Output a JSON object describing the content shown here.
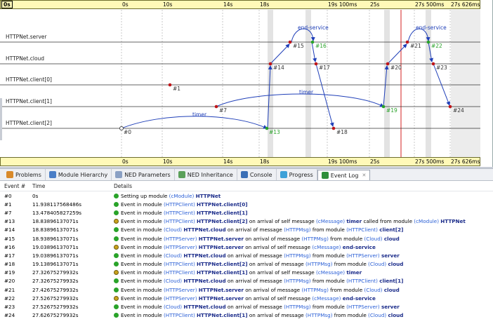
{
  "ruler": {
    "ticks": [
      "0s",
      "0s",
      "10s",
      "14s",
      "18s",
      "19s 100ms",
      "25s",
      "27s 500ms",
      "27s 626ms"
    ]
  },
  "lanes": [
    "HTTPNet.server",
    "HTTPNet.cloud",
    "HTTPNet.client[0]",
    "HTTPNet.client[1]",
    "HTTPNet.client[2]"
  ],
  "events": {
    "e0": "#0",
    "e1": "#1",
    "e7": "#7",
    "e13": "#13",
    "e14": "#14",
    "e15": "#15",
    "e16": "#16",
    "e17": "#17",
    "e18": "#18",
    "e19": "#19",
    "e20": "#20",
    "e21": "#21",
    "e22": "#22",
    "e23": "#23",
    "e24": "#24"
  },
  "msgs": {
    "timer1": "timer",
    "timer2": "timer",
    "end1": "end-service",
    "end2": "end-service"
  },
  "tabs": [
    {
      "label": "Problems",
      "icon": "problems-icon"
    },
    {
      "label": "Module Hierarchy",
      "icon": "module-hierarchy-icon"
    },
    {
      "label": "NED Parameters",
      "icon": "ned-parameters-icon"
    },
    {
      "label": "NED Inheritance",
      "icon": "ned-inheritance-icon"
    },
    {
      "label": "Console",
      "icon": "console-icon"
    },
    {
      "label": "Progress",
      "icon": "progress-icon"
    },
    {
      "label": "Event Log",
      "icon": "event-log-icon",
      "close": "✕"
    }
  ],
  "log_head": {
    "event": "Event #",
    "time": "Time",
    "details": "Details"
  },
  "log_rows": [
    {
      "ev": "#0",
      "time": "0s",
      "kind": "normal",
      "parts": [
        [
          "",
          "Setting up module "
        ],
        [
          "tn",
          "(cModule) "
        ],
        [
          "bn",
          "HTTPNet"
        ]
      ]
    },
    {
      "ev": "#1",
      "time": "11.938117568486s",
      "kind": "normal",
      "parts": [
        [
          "",
          "Event in module "
        ],
        [
          "tn",
          "(HTTPClient) "
        ],
        [
          "bn",
          "HTTPNet.client[0]"
        ]
      ]
    },
    {
      "ev": "#7",
      "time": "13.478405827259s",
      "kind": "normal",
      "parts": [
        [
          "",
          "Event in module "
        ],
        [
          "tn",
          "(HTTPClient) "
        ],
        [
          "bn",
          "HTTPNet.client[1]"
        ]
      ]
    },
    {
      "ev": "#13",
      "time": "18.83896137071s",
      "kind": "self",
      "parts": [
        [
          "",
          "Event in module "
        ],
        [
          "tn",
          "(HTTPClient) "
        ],
        [
          "bn",
          "HTTPNet.client[2]"
        ],
        [
          "",
          " on arrival of self message "
        ],
        [
          "tn",
          "(cMessage) "
        ],
        [
          "bn",
          "timer"
        ],
        [
          "",
          " called from module "
        ],
        [
          "tn",
          "(cModule) "
        ],
        [
          "bn",
          "HTTPNet"
        ]
      ]
    },
    {
      "ev": "#14",
      "time": "18.83896137071s",
      "kind": "normal",
      "parts": [
        [
          "",
          "Event in module "
        ],
        [
          "tn",
          "(Cloud) "
        ],
        [
          "bn",
          "HTTPNet.cloud"
        ],
        [
          "",
          " on arrival of message "
        ],
        [
          "tn",
          "(HTTPMsg)"
        ],
        [
          "",
          "  from module "
        ],
        [
          "tn",
          "(HTTPClient) "
        ],
        [
          "bn",
          "client[2]"
        ]
      ]
    },
    {
      "ev": "#15",
      "time": "18.93896137071s",
      "kind": "normal",
      "parts": [
        [
          "",
          "Event in module "
        ],
        [
          "tn",
          "(HTTPServer) "
        ],
        [
          "bn",
          "HTTPNet.server"
        ],
        [
          "",
          " on arrival of message "
        ],
        [
          "tn",
          "(HTTPMsg)"
        ],
        [
          "",
          "  from module "
        ],
        [
          "tn",
          "(Cloud) "
        ],
        [
          "bn",
          "cloud"
        ]
      ]
    },
    {
      "ev": "#16",
      "time": "19.03896137071s",
      "kind": "self",
      "parts": [
        [
          "",
          "Event in module "
        ],
        [
          "tn",
          "(HTTPServer) "
        ],
        [
          "bn",
          "HTTPNet.server"
        ],
        [
          "",
          " on arrival of self message "
        ],
        [
          "tn",
          "(cMessage) "
        ],
        [
          "bn",
          "end-service"
        ]
      ]
    },
    {
      "ev": "#17",
      "time": "19.03896137071s",
      "kind": "normal",
      "parts": [
        [
          "",
          "Event in module "
        ],
        [
          "tn",
          "(Cloud) "
        ],
        [
          "bn",
          "HTTPNet.cloud"
        ],
        [
          "",
          " on arrival of message "
        ],
        [
          "tn",
          "(HTTPMsg)"
        ],
        [
          "",
          "  from module "
        ],
        [
          "tn",
          "(HTTPServer) "
        ],
        [
          "bn",
          "server"
        ]
      ]
    },
    {
      "ev": "#18",
      "time": "19.13896137071s",
      "kind": "normal",
      "parts": [
        [
          "",
          "Event in module "
        ],
        [
          "tn",
          "(HTTPClient) "
        ],
        [
          "bn",
          "HTTPNet.client[2]"
        ],
        [
          "",
          " on arrival of message "
        ],
        [
          "tn",
          "(HTTPMsg)"
        ],
        [
          "",
          "  from module "
        ],
        [
          "tn",
          "(Cloud) "
        ],
        [
          "bn",
          "cloud"
        ]
      ]
    },
    {
      "ev": "#19",
      "time": "27.32675279932s",
      "kind": "self",
      "parts": [
        [
          "",
          "Event in module "
        ],
        [
          "tn",
          "(HTTPClient) "
        ],
        [
          "bn",
          "HTTPNet.client[1]"
        ],
        [
          "",
          " on arrival of self message "
        ],
        [
          "tn",
          "(cMessage) "
        ],
        [
          "bn",
          "timer"
        ]
      ]
    },
    {
      "ev": "#20",
      "time": "27.32675279932s",
      "kind": "normal",
      "parts": [
        [
          "",
          "Event in module "
        ],
        [
          "tn",
          "(Cloud) "
        ],
        [
          "bn",
          "HTTPNet.cloud"
        ],
        [
          "",
          " on arrival of message "
        ],
        [
          "tn",
          "(HTTPMsg)"
        ],
        [
          "",
          "  from module "
        ],
        [
          "tn",
          "(HTTPClient) "
        ],
        [
          "bn",
          "client[1]"
        ]
      ]
    },
    {
      "ev": "#21",
      "time": "27.42675279932s",
      "kind": "normal",
      "parts": [
        [
          "",
          "Event in module "
        ],
        [
          "tn",
          "(HTTPServer) "
        ],
        [
          "bn",
          "HTTPNet.server"
        ],
        [
          "",
          " on arrival of message "
        ],
        [
          "tn",
          "(HTTPMsg)"
        ],
        [
          "",
          "  from module "
        ],
        [
          "tn",
          "(Cloud) "
        ],
        [
          "bn",
          "cloud"
        ]
      ]
    },
    {
      "ev": "#22",
      "time": "27.52675279932s",
      "kind": "self",
      "parts": [
        [
          "",
          "Event in module "
        ],
        [
          "tn",
          "(HTTPServer) "
        ],
        [
          "bn",
          "HTTPNet.server"
        ],
        [
          "",
          " on arrival of self message "
        ],
        [
          "tn",
          "(cMessage) "
        ],
        [
          "bn",
          "end-service"
        ]
      ]
    },
    {
      "ev": "#23",
      "time": "27.52675279932s",
      "kind": "normal",
      "parts": [
        [
          "",
          "Event in module "
        ],
        [
          "tn",
          "(Cloud) "
        ],
        [
          "bn",
          "HTTPNet.cloud"
        ],
        [
          "",
          " on arrival of message "
        ],
        [
          "tn",
          "(HTTPMsg)"
        ],
        [
          "",
          "  from module "
        ],
        [
          "tn",
          "(HTTPServer) "
        ],
        [
          "bn",
          "server"
        ]
      ]
    },
    {
      "ev": "#24",
      "time": "27.62675279932s",
      "kind": "normal",
      "parts": [
        [
          "",
          "Event in module "
        ],
        [
          "tn",
          "(HTTPClient) "
        ],
        [
          "bn",
          "HTTPNet.client[1]"
        ],
        [
          "",
          " on arrival of message "
        ],
        [
          "tn",
          "(HTTPMsg)"
        ],
        [
          "",
          "  from module "
        ],
        [
          "tn",
          "(Cloud) "
        ],
        [
          "bn",
          "cloud"
        ]
      ]
    }
  ],
  "colors": {
    "event_dot": "#c0161a",
    "self_msg": "#29a329",
    "msg_arrow": "#1f3fb8",
    "ruler_bg": "#fff9b8"
  }
}
